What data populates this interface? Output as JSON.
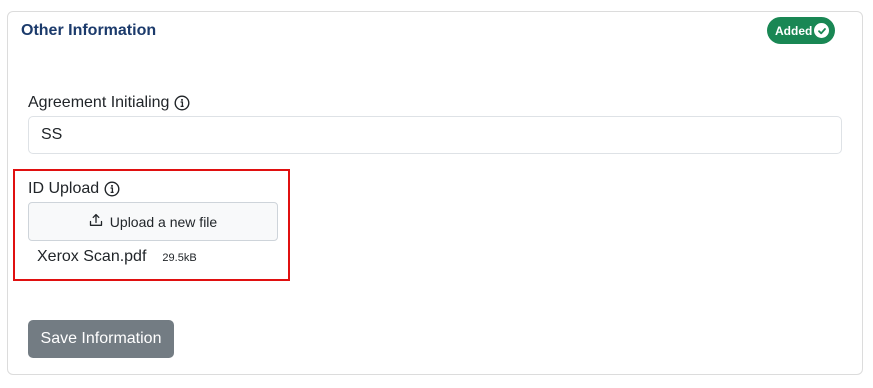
{
  "section": {
    "title": "Other Information",
    "badge": "Added",
    "badge_color": "#198754"
  },
  "agreement": {
    "label": "Agreement Initialing",
    "value": "SS",
    "info_icon": "info-circle-icon"
  },
  "id_upload": {
    "label": "ID Upload",
    "info_icon": "info-circle-icon",
    "button_label": "Upload a new file",
    "button_icon": "upload-icon",
    "file_name": "Xerox Scan.pdf",
    "file_size": "29.5kB",
    "highlight_color": "#e01010"
  },
  "actions": {
    "save_label": "Save Information"
  }
}
